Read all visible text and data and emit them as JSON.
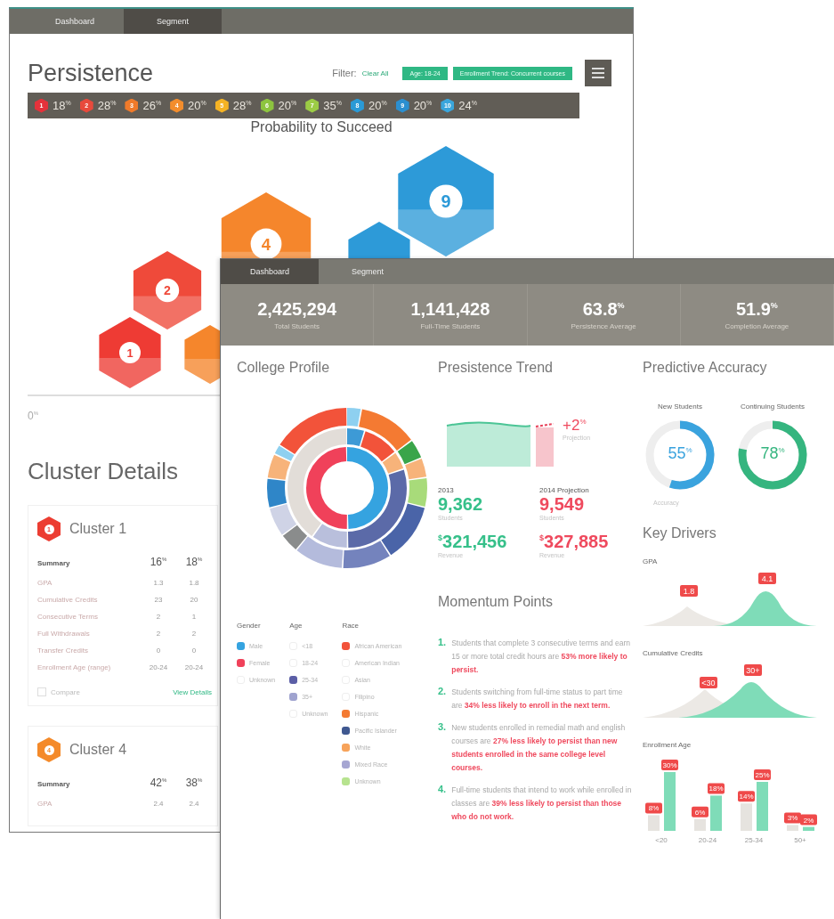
{
  "back_window": {
    "tabs": [
      {
        "label": "Dashboard",
        "selected": false
      },
      {
        "label": "Segment",
        "selected": true
      }
    ],
    "title": "Persistence",
    "filter": {
      "label": "Filter:",
      "clear": "Clear All",
      "chips": [
        "Age: 18-24",
        "Enrollment Trend: Concurrent courses"
      ]
    },
    "clusters": [
      {
        "number": "1",
        "value": "18$^{%}$",
        "color": "#e5323b"
      },
      {
        "number": "2",
        "value": "28$^{%}$",
        "color": "#e84a3c"
      },
      {
        "number": "3",
        "value": "26$^{%}$",
        "color": "#f07a2a"
      },
      {
        "number": "4",
        "value": "20$^{%}$",
        "color": "#f38d2c"
      },
      {
        "number": "5",
        "value": "28$^{%}$",
        "color": "#f5b324"
      },
      {
        "number": "6",
        "value": "20$^{%}$",
        "color": "#8dc43f"
      },
      {
        "number": "7",
        "value": "35$^{%}$",
        "color": "#9ccc45"
      },
      {
        "number": "8",
        "value": "20$^{%}$",
        "color": "#2a9ad6"
      },
      {
        "number": "9",
        "value": "20$^{%}$",
        "color": "#2b8fd0"
      },
      {
        "number": "10",
        "value": "24$^{%}$",
        "color": "#3aa6dc"
      }
    ],
    "chart_title": "Probability to Succeed",
    "hexagons": [
      {
        "number": "1",
        "color": "#ee3b34"
      },
      {
        "number": "2",
        "color": "#ef4a3a"
      },
      {
        "color": "#f5862c"
      },
      {
        "number": "4",
        "color": "#f5862c"
      },
      {
        "color": "#2d9ad8"
      },
      {
        "number": "9",
        "color": "#2d9ad8"
      }
    ],
    "axis_label": "0$^{%}$",
    "details_title": "Cluster Details",
    "cards": [
      {
        "title": "Cluster 1",
        "badge": "1",
        "color": "#ec3d32",
        "summary": [
          "Summary",
          "16$^{%}$",
          "18$^{%}$"
        ],
        "rows": [
          [
            "GPA",
            "1.3",
            "1.8"
          ],
          [
            "Cumulative Credits",
            "23",
            "20"
          ],
          [
            "Consecutive Terms",
            "2",
            "1"
          ],
          [
            "Full Withdrawals",
            "2",
            "2"
          ],
          [
            "Transfer Credits",
            "0",
            "0"
          ],
          [
            "Enrollment Age (range)",
            "20-24",
            "20-24"
          ]
        ],
        "compare": {
          "label": "Compare",
          "checked": false
        },
        "link": "View Details"
      },
      {
        "title": "Cluster 4",
        "badge": "4",
        "color": "#f48a2a",
        "summary": [
          "Summary",
          "42$^{%}$",
          "38$^{%}$"
        ],
        "rows": [
          [
            "GPA",
            "2.4",
            "2.4"
          ]
        ]
      }
    ]
  },
  "front_window": {
    "tabs": [
      {
        "label": "Dashboard",
        "selected": true
      },
      {
        "label": "Segment",
        "selected": false
      }
    ],
    "stats": [
      {
        "value": "2,425,294",
        "label": "Total Students"
      },
      {
        "value": "1,141,428",
        "label": "Full-Time Students"
      },
      {
        "value": "63.8$^{%}$",
        "label": "Persistence Average"
      },
      {
        "value": "51.9$^{%}$",
        "label": "Completion Average"
      }
    ],
    "profile": {
      "title": "College Profile",
      "legend": [
        {
          "heading": "Gender",
          "items": [
            {
              "label": "Male",
              "color": "#35a3e0"
            },
            {
              "label": "Female",
              "color": "#f0415a"
            },
            {
              "label": "Unknown"
            }
          ]
        },
        {
          "heading": "Age",
          "items": [
            {
              "label": "<18"
            },
            {
              "label": "18-24"
            },
            {
              "label": "25-34",
              "color": "#5b5ea6"
            },
            {
              "label": "35+",
              "color": "#9fa3cf"
            },
            {
              "label": "Unknown"
            }
          ]
        },
        {
          "heading": "Race",
          "items": [
            {
              "label": "African American",
              "color": "#f2533a"
            },
            {
              "label": "American Indian"
            },
            {
              "label": "Asian"
            },
            {
              "label": "Filipino"
            },
            {
              "label": "Hispanic",
              "color": "#f47a32"
            },
            {
              "label": "Pacific Islander",
              "color": "#3f5890"
            },
            {
              "label": "White",
              "color": "#f7a35a"
            },
            {
              "label": "Mixed Race",
              "color": "#a6a6d2"
            },
            {
              "label": "Unknown",
              "color": "#b7e38f"
            }
          ]
        }
      ]
    },
    "trend": {
      "title": "Presistence Trend",
      "change": "+2$^{%}$",
      "change_label": "Projection",
      "figures": [
        {
          "caption": "2013",
          "value": "9,362",
          "sublabel": "Students",
          "kind": "actual"
        },
        {
          "caption": "2014 Projection",
          "value": "9,549",
          "sublabel": "Students",
          "kind": "projection"
        },
        {
          "currency": "$",
          "value": "321,456",
          "sublabel": "Revenue",
          "kind": "actual"
        },
        {
          "currency": "$",
          "value": "327,885",
          "sublabel": "Revenue",
          "kind": "projection"
        }
      ]
    },
    "momentum": {
      "title": "Momentum Points",
      "points": [
        {
          "number": "1.",
          "text": "Students that complete 3 consecutive terms and earn 15 or more total credit hours are **53% more likely to persist.**"
        },
        {
          "number": "2.",
          "text": "Students switching from full-time status to part time are **34% less likely to enroll in the next term.**"
        },
        {
          "number": "3.",
          "text": "New students enrolled in remedial math and english courses are **27% less likely to persist than new students enrolled in the same college level courses.**"
        },
        {
          "number": "4.",
          "text": "Full-time students that intend to work while enrolled in classes are **39% less likely to persist than those who do not work.**"
        }
      ]
    },
    "accuracy": {
      "title": "Predictive Accuracy",
      "caption": "Accuracy",
      "rings": [
        {
          "label": "New Students",
          "value": "55$^{%}$",
          "level": 0.55,
          "color": "#3aa3de"
        },
        {
          "label": "Continuing Students",
          "value": "78$^{%}$",
          "level": 0.78,
          "color": "#35b57f"
        }
      ]
    },
    "drivers": {
      "title": "Key Drivers",
      "items": [
        {
          "title": "GPA",
          "kind": "curve",
          "tags": [
            "1.8",
            "4.1"
          ]
        },
        {
          "title": "Cumulative Credits",
          "kind": "curve",
          "tags": [
            "<30",
            "30+"
          ]
        },
        {
          "title": "Enrollment Age",
          "kind": "bars",
          "chart_data": {
            "type": "bar",
            "categories": [
              "<20",
              "20-24",
              "25-34",
              "50+"
            ],
            "data_labels": true,
            "series": [
              {
                "color": "#e6e3df",
                "values": [
                  8,
                  6,
                  14,
                  3
                ],
                "value_labels": [
                  "8%",
                  "6%",
                  "14%",
                  "3%"
                ]
              },
              {
                "color": "#7fdcb8",
                "values": [
                  30,
                  18,
                  25,
                  2
                ],
                "value_labels": [
                  "30%",
                  "18%",
                  "25%",
                  "2%"
                ]
              }
            ]
          }
        }
      ]
    }
  }
}
